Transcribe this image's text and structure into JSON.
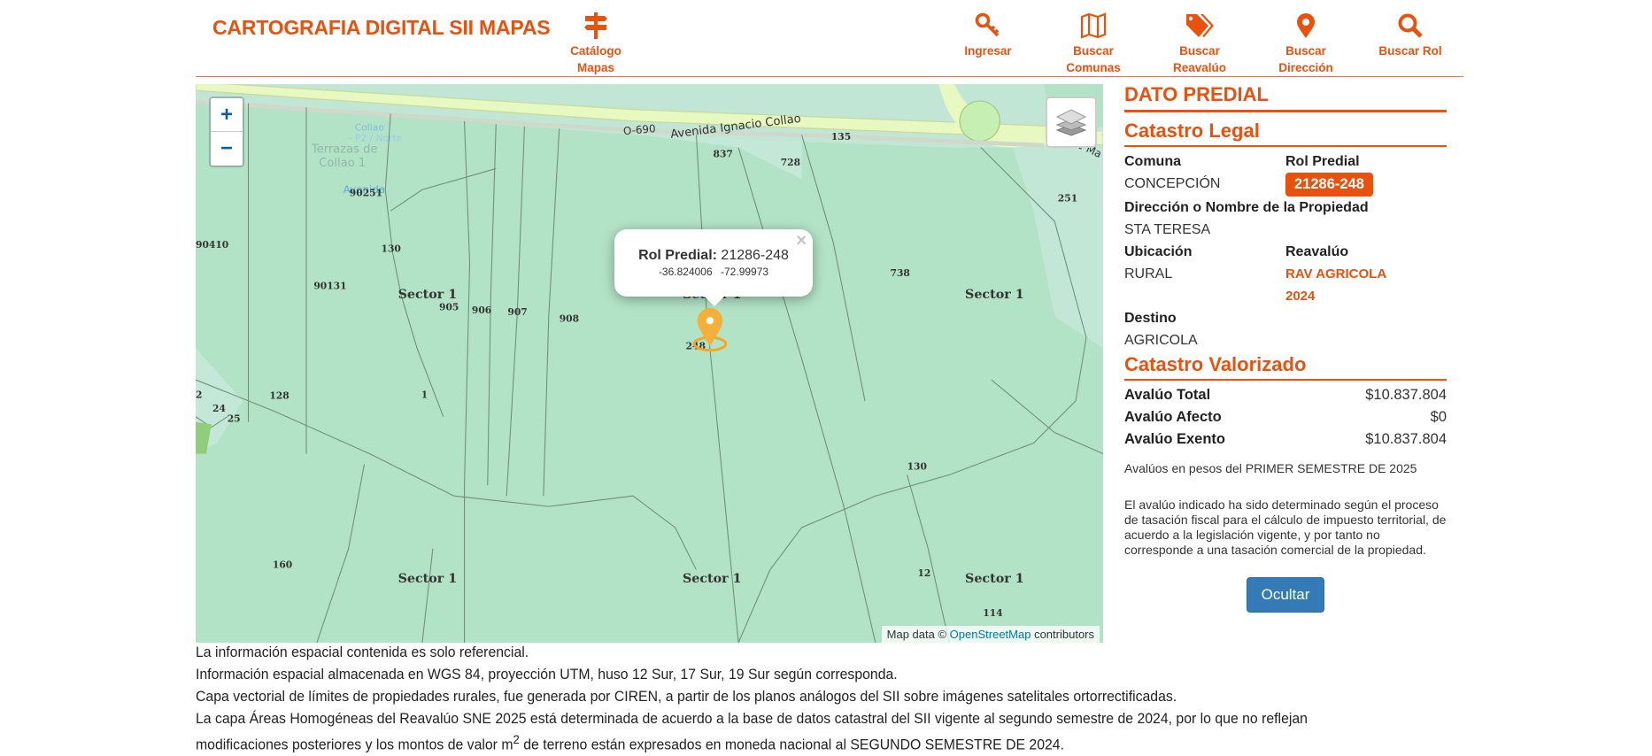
{
  "header": {
    "title": "CARTOGRAFIA DIGITAL SII MAPAS",
    "nav": [
      {
        "label1": "Catálogo",
        "label2": "Mapas",
        "icon": "signpost-icon"
      },
      {
        "label1": "Ingresar",
        "label2": "",
        "icon": "key-icon"
      },
      {
        "label1": "Buscar",
        "label2": "Comunas",
        "icon": "map-icon"
      },
      {
        "label1": "Buscar",
        "label2": "Reavalúo",
        "icon": "tags-icon"
      },
      {
        "label1": "Buscar",
        "label2": "Dirección",
        "icon": "map-marker-icon"
      },
      {
        "label1": "Buscar Rol",
        "label2": "",
        "icon": "search-icon"
      }
    ]
  },
  "map": {
    "zoom_in": "+",
    "zoom_out": "−",
    "popup": {
      "label": "Rol Predial:",
      "rol": "21286-248",
      "lat": "-36.824006",
      "lon": "-72.99973",
      "close": "×"
    },
    "attribution": {
      "prefix": "Map data ©",
      "link": "OpenStreetMap",
      "suffix": "contributors"
    },
    "labels": {
      "road1": "Avenida Ignacio Collao",
      "route": "O-690",
      "stop1": "Avenida",
      "stop2": "Collao",
      "stop3": "- P2 / Norte",
      "terr1": "Terrazas de",
      "terr2": "Collao 1",
      "road2": "de Ma",
      "sector_a": "Sector 1",
      "sector_b": "Sector 1",
      "sector_c": "Sector 1",
      "sector_d": "Sector 1",
      "sector_e": "Sector 1",
      "sector_f": "Sector 1",
      "n837": "837",
      "n728": "728",
      "n135": "135",
      "n251": "251",
      "n90251": "90251",
      "n90410": "90410",
      "n130a": "130",
      "n90131": "90131",
      "n905": "905",
      "n906": "906",
      "n907": "907",
      "n908": "908",
      "n738": "738",
      "n248": "248",
      "n128": "128",
      "n1": "1",
      "n2": "2",
      "n24": "24",
      "n25": "25",
      "n130b": "130",
      "n160": "160",
      "n12": "12",
      "n114": "114"
    }
  },
  "panel": {
    "title": "DATO PREDIAL",
    "legal_title": "Catastro Legal",
    "comuna_label": "Comuna",
    "comuna": "CONCEPCIÓN",
    "rol_label": "Rol Predial",
    "rol": "21286-248",
    "direccion_label": "Dirección o Nombre de la Propiedad",
    "direccion": "STA TERESA",
    "ubicacion_label": "Ubicación",
    "ubicacion": "RURAL",
    "reavaluo_label": "Reavalúo",
    "reavaluo1": "RAV AGRICOLA",
    "reavaluo2": "2024",
    "destino_label": "Destino",
    "destino": "AGRICOLA",
    "valorizado_title": "Catastro Valorizado",
    "avaluos": [
      {
        "label": "Avalúo Total",
        "value": "$10.837.804"
      },
      {
        "label": "Avalúo Afecto",
        "value": "$0"
      },
      {
        "label": "Avalúo Exento",
        "value": "$10.837.804"
      }
    ],
    "note": "Avalúos en pesos del PRIMER SEMESTRE DE 2025",
    "disclaimer": "El avalúo indicado ha sido determinado según el proceso de tasación fiscal para el cálculo de impuesto territorial, de acuerdo a la legislación vigente, y por tanto no corresponde a una tasación comercial de la propiedad.",
    "hide_button": "Ocultar"
  },
  "footer": {
    "line1": "La información espacial contenida es solo referencial.",
    "line2": "Información espacial almacenada en WGS 84, proyección UTM, huso 12 Sur, 17 Sur, 19 Sur según corresponda.",
    "line3": "Capa vectorial de límites de propiedades rurales, fue generada por CIREN, a partir de los planos análogos del SII sobre imágenes satelitales ortorrectificadas.",
    "line4": "La capa Áreas Homogéneas del Reavalúo SNE 2025 está determinada de acuerdo a la base de datos catastral del SII vigente al segundo semestre de 2024, por lo que no reflejan",
    "line5a": "modificaciones posteriores y los montos de valor m",
    "line5sup": "2",
    "line5b": " de terreno están expresados en moneda nacional al SEGUNDO SEMESTRE DE 2024."
  },
  "colors": {
    "brand": "#e8510e",
    "button": "#337ab7",
    "marker": "#f5a623",
    "map_bg": "#b3e3c6"
  }
}
